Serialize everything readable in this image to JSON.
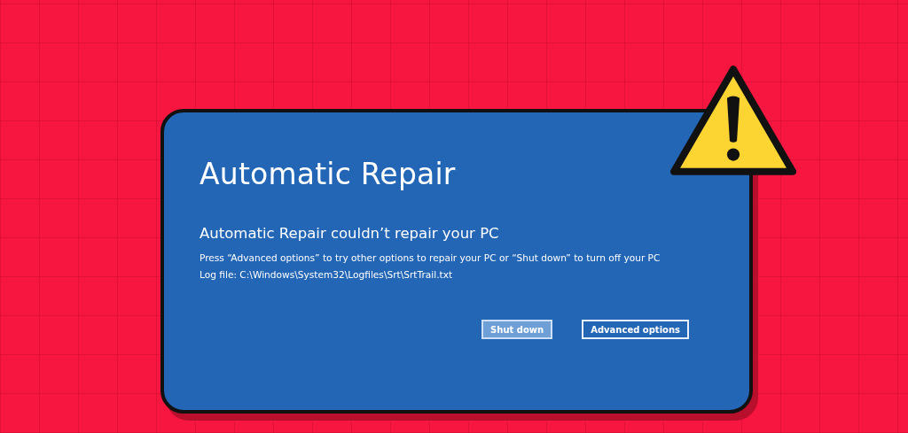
{
  "screen": {
    "title": "Automatic Repair",
    "heading": "Automatic Repair couldn’t repair your PC",
    "message": "Press “Advanced options” to try other options to repair your PC or “Shut down” to turn off your PC",
    "log": "Log file: C:\\Windows\\System32\\Logfiles\\Srt\\SrtTrail.txt",
    "buttons": [
      {
        "label": "Shut down",
        "focused": true
      },
      {
        "label": "Advanced options",
        "focused": false
      }
    ]
  }
}
